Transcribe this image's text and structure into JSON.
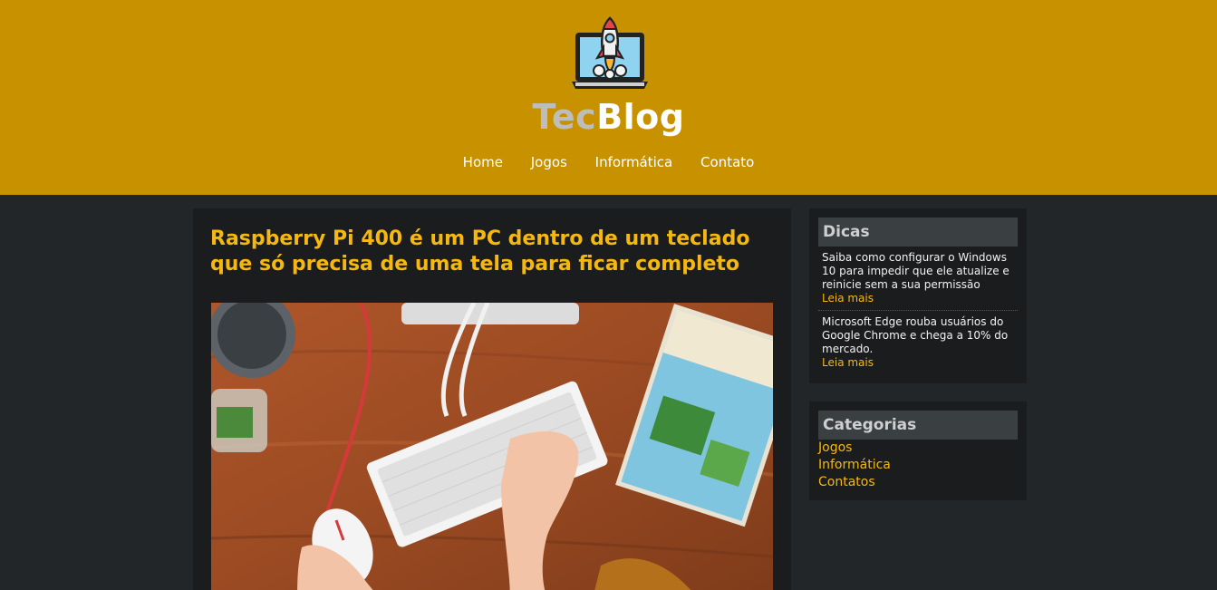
{
  "brand": {
    "part1": "Tec",
    "part2": "Blog"
  },
  "nav": [
    "Home",
    "Jogos",
    "Informática",
    "Contato"
  ],
  "article": {
    "title": "Raspberry Pi 400 é um PC dentro de um teclado que só precisa de uma tela para ficar completo"
  },
  "tips": {
    "heading": "Dicas",
    "items": [
      {
        "text": "Saiba como configurar o Windows 10 para impedir que ele atualize e reinicie sem a sua permissão",
        "more": "Leia mais"
      },
      {
        "text": "Microsoft Edge rouba usuários do Google Chrome e chega a 10% do mercado.",
        "more": "Leia mais"
      }
    ]
  },
  "categories": {
    "heading": "Categorias",
    "items": [
      "Jogos",
      "Informática",
      "Contatos"
    ]
  },
  "colors": {
    "header_bg": "#c79100",
    "page_bg": "#222629",
    "accent": "#f5b811"
  },
  "icons": {
    "logo": "rocket-laptop-icon"
  }
}
